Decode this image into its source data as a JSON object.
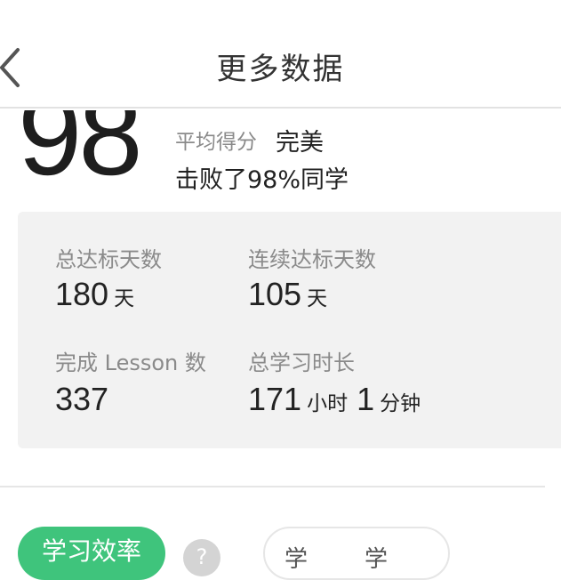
{
  "header": {
    "title": "更多数据",
    "back_icon": "chevron-left-icon"
  },
  "score": {
    "value": "98",
    "avg_label": "平均得分",
    "avg_value": "完美",
    "beat_text": "击败了98%同学"
  },
  "stats": [
    {
      "label": "总达标天数",
      "parts": [
        {
          "num": "180",
          "unit": "天"
        }
      ]
    },
    {
      "label": "连续达标天数",
      "parts": [
        {
          "num": "105",
          "unit": "天"
        }
      ]
    },
    {
      "label": "完成 Lesson 数",
      "parts": [
        {
          "num": "337",
          "unit": ""
        }
      ]
    },
    {
      "label": "总学习时长",
      "parts": [
        {
          "num": "171",
          "unit": "小时"
        },
        {
          "num": "1",
          "unit": "分钟"
        }
      ]
    }
  ],
  "bottom": {
    "green_tab": "学习效率",
    "help_icon": "question-circle-icon",
    "help_text": "?",
    "outline_tab_left": "学",
    "outline_tab_right": "学"
  },
  "colors": {
    "accent_green": "#3fc47c",
    "card_bg": "#f2f2f2",
    "label_gray": "#8a8a8a"
  }
}
